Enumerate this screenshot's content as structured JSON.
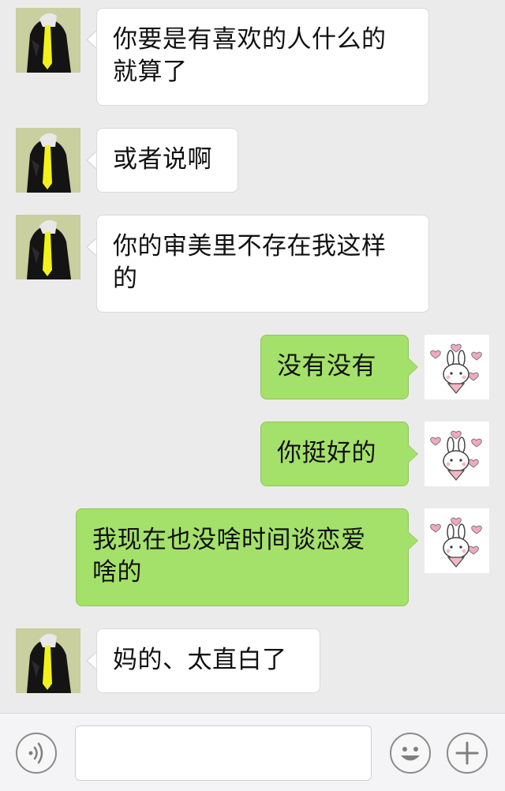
{
  "messages": [
    {
      "side": "left",
      "text": "你要是有喜欢的人什么的\n就算了",
      "avatar": "suit-figure-avatar"
    },
    {
      "side": "left",
      "text": "或者说啊",
      "avatar": "suit-figure-avatar"
    },
    {
      "side": "left",
      "text": "你的审美里不存在我这样\n的",
      "avatar": "suit-figure-avatar"
    },
    {
      "side": "right",
      "text": "没有没有",
      "avatar": "bunny-hearts-avatar"
    },
    {
      "side": "right",
      "text": "你挺好的",
      "avatar": "bunny-hearts-avatar"
    },
    {
      "side": "right",
      "text": "我现在也没啥时间谈恋爱\n啥的",
      "avatar": "bunny-hearts-avatar"
    },
    {
      "side": "left",
      "text": "妈的、太直白了",
      "avatar": "suit-figure-avatar"
    }
  ],
  "toolbar": {
    "voice_icon": "voice-icon",
    "input_value": "",
    "emoji_icon": "emoji-icon",
    "plus_icon": "plus-icon"
  },
  "colors": {
    "background": "#ebebeb",
    "bubble_left": "#ffffff",
    "bubble_right": "#a4e16a",
    "toolbar": "#f4f4f6"
  }
}
